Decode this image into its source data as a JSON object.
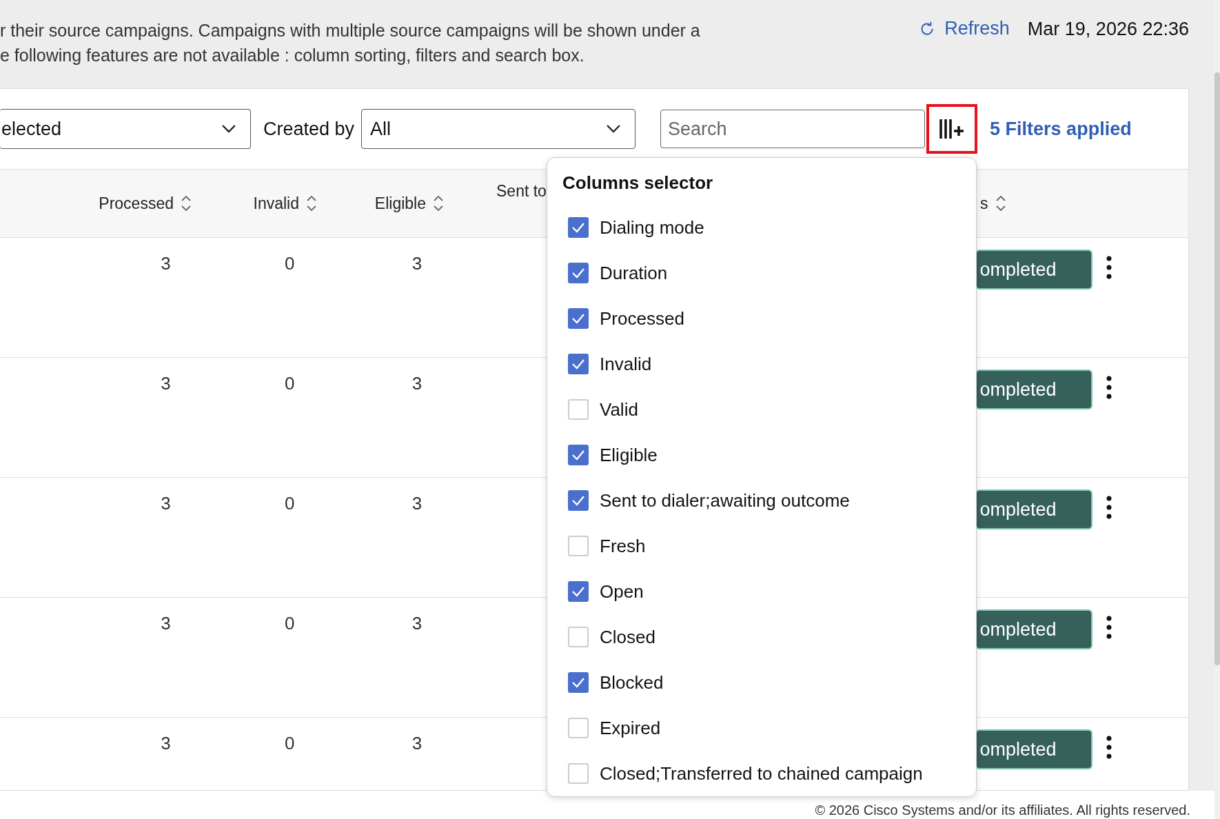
{
  "notice": {
    "lines": [
      "r their source campaigns. Campaigns with multiple source campaigns will be shown under a",
      "e following features are not available : column sorting, filters and search box."
    ]
  },
  "refresh": {
    "label": "Refresh"
  },
  "timestamp": "Mar 19, 2026 22:36",
  "filters": {
    "status_select": {
      "value": "elected"
    },
    "created_by": {
      "label": "Created by",
      "value": "All"
    },
    "search": {
      "placeholder": "Search"
    },
    "column_selector_button": {
      "highlighted": true
    },
    "filters_link": "5 Filters applied"
  },
  "table": {
    "columns": [
      {
        "label": "Processed",
        "sortable": true
      },
      {
        "label": "Invalid",
        "sortable": true
      },
      {
        "label": "Eligible",
        "sortable": true
      },
      {
        "label": "Sent to",
        "sortable": false
      },
      {
        "label": "s",
        "sortable": true
      }
    ],
    "rows": [
      {
        "processed": "3",
        "invalid": "0",
        "eligible": "3",
        "status": "ompleted"
      },
      {
        "processed": "3",
        "invalid": "0",
        "eligible": "3",
        "status": "ompleted"
      },
      {
        "processed": "3",
        "invalid": "0",
        "eligible": "3",
        "status": "ompleted"
      },
      {
        "processed": "3",
        "invalid": "0",
        "eligible": "3",
        "status": "ompleted"
      },
      {
        "processed": "3",
        "invalid": "0",
        "eligible": "3",
        "status": "ompleted"
      }
    ]
  },
  "columns_selector": {
    "title": "Columns selector",
    "items": [
      {
        "label": "Dialing mode",
        "checked": true
      },
      {
        "label": "Duration",
        "checked": true
      },
      {
        "label": "Processed",
        "checked": true
      },
      {
        "label": "Invalid",
        "checked": true
      },
      {
        "label": "Valid",
        "checked": false
      },
      {
        "label": "Eligible",
        "checked": true
      },
      {
        "label": "Sent to dialer;awaiting outcome",
        "checked": true
      },
      {
        "label": "Fresh",
        "checked": false
      },
      {
        "label": "Open",
        "checked": true
      },
      {
        "label": "Closed",
        "checked": false
      },
      {
        "label": "Blocked",
        "checked": true
      },
      {
        "label": "Expired",
        "checked": false
      },
      {
        "label": "Closed;Transferred to chained campaign",
        "checked": false
      }
    ]
  },
  "footer": "© 2026 Cisco Systems and/or its affiliates. All rights reserved."
}
